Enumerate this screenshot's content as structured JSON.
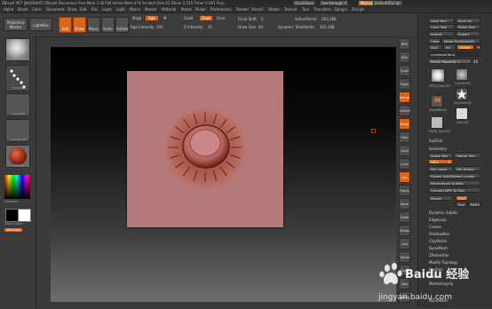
{
  "titlebar": {
    "title": "ZBrush 4R7 [JHJQS8H5]  ZBrush Document  Free Mem 3.45748  Active Mem 474  Scratch Disk 61  Ztime 2.515  Timer 0.001  Poly...",
    "quicksave": "QuickSave",
    "seethrough": "See-through 0",
    "menus": "Menus",
    "script": "DefaultZScript"
  },
  "menubar": {
    "items": [
      "Alpha",
      "Brush",
      "Color",
      "Document",
      "Draw",
      "Edit",
      "File",
      "Layer",
      "Light",
      "Macro",
      "Marker",
      "Material",
      "Movie",
      "Picker",
      "Preferences",
      "Render",
      "Stencil",
      "Stroke",
      "Texture",
      "Tool",
      "Transform",
      "Zplugin",
      "Zscript"
    ]
  },
  "shelf": {
    "projection_master": "Projection Master",
    "lightbox": "LightBox",
    "edit": "Edit",
    "draw": "Draw",
    "move": "Move",
    "scale": "Scale",
    "rotate": "Rotate",
    "mrgb": "Mrgb",
    "rgb": "Rgb",
    "m": "M",
    "rgb_intensity_label": "Rgb Intensity",
    "rgb_intensity": "100",
    "zadd": "Zadd",
    "zsub": "Zsub",
    "zcut": "Zcut",
    "z_intensity_label": "Z Intensity",
    "z_intensity": "25",
    "focal_shift_label": "Focal Shift",
    "focal_shift": "0",
    "draw_size_label": "Draw Size",
    "draw_size": "64",
    "dynamic": "Dynamic",
    "active_points_label": "ActivePoints:",
    "active_points": "263,168",
    "total_points_label": "TotalPoints:",
    "total_points": "263,168"
  },
  "leftshelf": {
    "tiles": [
      "Standard",
      "DragRect",
      "Alpha Off",
      "Texture Off",
      "MatCap"
    ],
    "gradient": "Gradient",
    "switchcolor": "SwitchColor",
    "alternate": "Alternate"
  },
  "righttools": [
    "BPR",
    "SPix",
    "Scroll",
    "Zoom",
    "Actual",
    "AAHalf",
    "Persp",
    "Floor",
    "Local",
    "LSym",
    "Xyz",
    "Frame",
    "Move",
    "Scale",
    "Rotate",
    "Line Fill",
    "Transp",
    "Ghost",
    "Solo",
    "Xpose"
  ],
  "rightpanel": {
    "load_tool": "Load Tool",
    "save_as": "Save As",
    "copy_tool": "Copy Tool",
    "paste_tool": "Paste Tool",
    "import": "Import",
    "export": "Export",
    "clone": "Clone",
    "make_polymesh": "Make PolyMesh3D",
    "goz": "GoZ",
    "all": "All",
    "visible": "Visible",
    "r": "R",
    "lightbox_tools": "Lightbox▸Tools",
    "current_tool": "PM3D_Plane3D_1",
    "current_tool_count": "48",
    "thumbs": [
      "PM3D_Plane3D",
      "Cylinder3D",
      "PolyMesh3D",
      "SimpleBrush",
      "Plane3D",
      "PM3D_Plane3D"
    ],
    "subtool": "SubTool",
    "geometry": "Geometry",
    "lower_res": "Lower Res",
    "higher_res": "Higher Res",
    "sdiv": "SDiv",
    "sdiv_value": "1",
    "del_lower": "Del Lower",
    "del_higher": "Del Higher",
    "freeze": "Freeze SubDivision Levels",
    "reconstruct": "Reconstruct Subdiv",
    "convert_bpr": "Convert BPR To Geo",
    "divide": "Divide",
    "smt": "Smt",
    "suv": "Suv",
    "reuv": "ReUV",
    "list": [
      "Dynamic Subdiv",
      "EdgeLoop",
      "Crease",
      "ShadowBox",
      "ClayPolish",
      "DynaMesh",
      "ZRemesher",
      "Modify Topology",
      "Position",
      "Size",
      "MeshIntegrity"
    ],
    "nano": "NanoMesh"
  },
  "watermark": {
    "brand": "Baidu 经验",
    "url": "jingyan.baidu.com"
  },
  "colors": {
    "accent": "#d9651c",
    "canvas_doc": "#b47a7b",
    "disc": "#a44a3c"
  }
}
